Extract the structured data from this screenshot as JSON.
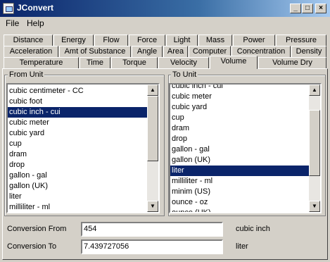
{
  "window": {
    "title": "JConvert",
    "minimize": "_",
    "maximize": "□",
    "close": "×"
  },
  "menu": [
    "File",
    "Help"
  ],
  "tabs": {
    "row1": [
      "Distance",
      "Energy",
      "Flow",
      "Force",
      "Light",
      "Mass",
      "Power",
      "Pressure"
    ],
    "row2": [
      "Acceleration",
      "Amt of Substance",
      "Angle",
      "Area",
      "Computer",
      "Concentration",
      "Density"
    ],
    "row3": [
      "Temperature",
      "Time",
      "Torque",
      "Velocity",
      "Volume",
      "Volume Dry"
    ],
    "active": "Volume"
  },
  "from_unit": {
    "label": "From Unit",
    "items": [
      "cubic centimeter - CC",
      "cubic foot",
      "cubic inch - cui",
      "cubic meter",
      "cubic yard",
      "cup",
      "dram",
      "drop",
      "gallon - gal",
      "gallon (UK)",
      "liter",
      "milliliter - ml"
    ],
    "selected": "cubic inch - cui"
  },
  "to_unit": {
    "label": "To Unit",
    "items": [
      "cubic inch - cui",
      "cubic meter",
      "cubic yard",
      "cup",
      "dram",
      "drop",
      "gallon - gal",
      "gallon (UK)",
      "liter",
      "milliliter - ml",
      "minim (US)",
      "ounce - oz",
      "ounce (UK)"
    ],
    "selected": "liter"
  },
  "conversion": {
    "from_label": "Conversion From",
    "from_value": "454",
    "from_unit": "cubic inch",
    "to_label": "Conversion To",
    "to_value": "7.439727056",
    "to_unit": "liter"
  }
}
